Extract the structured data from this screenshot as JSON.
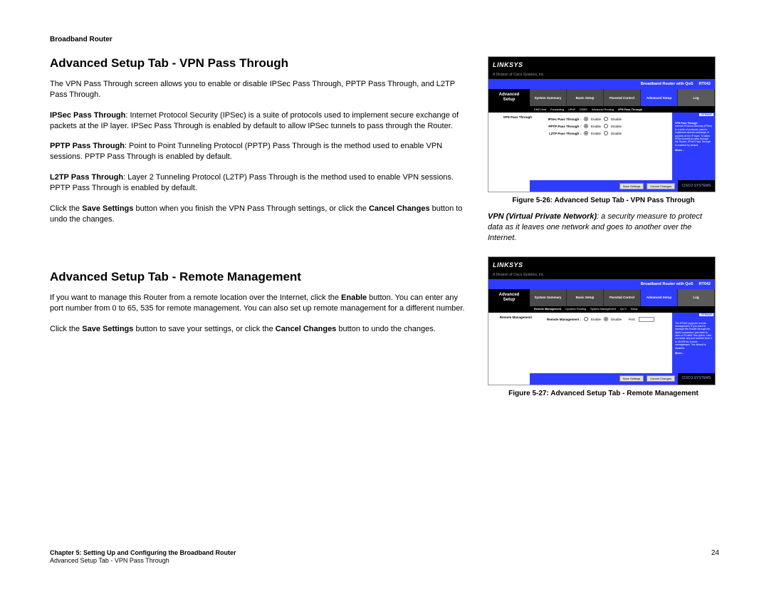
{
  "header": "Broadband Router",
  "section1": {
    "title": "Advanced Setup Tab - VPN Pass Through",
    "p1": "The VPN Pass Through screen allows you to enable or disable IPSec Pass Through, PPTP Pass Through, and L2TP Pass Through.",
    "p2_b": "IPSec Pass Through",
    "p2": ": Internet Protocol Security (IPSec) is a suite of protocols used to implement secure exchange of packets at the IP layer. IPSec Pass Through is enabled by default to allow IPSec tunnels to pass through the Router.",
    "p3_b": "PPTP Pass Through",
    "p3": ": Point to Point Tunneling Protocol (PPTP) Pass Through is the method used to enable VPN sessions. PPTP Pass Through is enabled by default.",
    "p4_b": "L2TP Pass Through",
    "p4": ": Layer 2 Tunneling Protocol (L2TP) Pass Through is the method used to enable VPN sessions. PPTP Pass Through is enabled by default.",
    "p5a": "Click the ",
    "p5b1": "Save Settings",
    "p5b": " button when you finish the VPN Pass Through settings, or click the ",
    "p5b2": "Cancel Changes",
    "p5c": " button to undo the changes."
  },
  "section2": {
    "title": "Advanced Setup Tab - Remote Management",
    "p1a": "If you want to manage this Router from a remote location over the Internet, click the ",
    "p1b": "Enable",
    "p1c": " button. You can enter any port number from 0 to 65, 535 for remote management. You can also set up remote management for a different number.",
    "p2a": "Click the ",
    "p2b1": "Save Settings",
    "p2b": " button to save your settings, or click the ",
    "p2b2": "Cancel Changes",
    "p2c": " button to undo the changes."
  },
  "fig1": {
    "caption": "Figure 5-26: Advanced Setup Tab - VPN Pass Through",
    "brand": "LINKSYS",
    "brand_sub": "A Division of Cisco Systems, Inc.",
    "product": "Broadband Router with QoS",
    "model": "RT042",
    "nav_left1": "Advanced",
    "nav_left2": "Setup",
    "tabs": [
      "System Summary",
      "Basic Setup",
      "Parental Control",
      "Advanced Setup",
      "Log"
    ],
    "subnav": [
      "DMZ Host",
      "Forwarding",
      "UPnP",
      "DDNS",
      "Advanced Routing",
      "VPN Pass Through"
    ],
    "side_label": "VPN Pass Through",
    "rows": [
      {
        "label": "IPSec Pass Through :",
        "a": "Enable",
        "b": "Disable"
      },
      {
        "label": "PPTP Pass Through :",
        "a": "Enable",
        "b": "Disable"
      },
      {
        "label": "L2TP Pass Through :",
        "a": "Enable",
        "b": "Disable"
      }
    ],
    "help_title": "VPN Pass Through",
    "help_text": "Internet Protocol Security (IPSec) is a suite of protocols used to implement secure exchange of packets at the IP layer. To allow IPSec tunnels to pass through the Router, IPSec Pass Through is enabled by default.",
    "more": "More...",
    "btn_save": "Save Settings",
    "btn_cancel": "Cancel Changes",
    "sitemap": "SITEMAP",
    "cisco": "CISCO SYSTEMS"
  },
  "fig2": {
    "caption": "Figure 5-27: Advanced Setup Tab - Remote Management",
    "side_label": "Remote Management",
    "subnav": [
      "Remote Management",
      "Dynamic Routing",
      "System Management",
      "Qo S",
      "Setup"
    ],
    "row_label": "Remote Management :",
    "enable": "Enable",
    "disable": "Disable",
    "port": "Port:",
    "help_title": "",
    "help_text": "The RT042 supports remote management. If you want to manage this Router through the WAN connection, you have to click on 'Enable' first option. User can enter any port number from 0 to 65,535 for remote management. The default is disabled.",
    "more": "More..."
  },
  "definition": {
    "b": "VPN (Virtual Private Network)",
    "rest": ": a security measure to protect data as it leaves one network and goes to another over the Internet."
  },
  "footer": {
    "l1": "Chapter 5: Setting Up and Configuring the Broadband Router",
    "l2": "Advanced Setup Tab - VPN Pass Through",
    "page": "24"
  }
}
